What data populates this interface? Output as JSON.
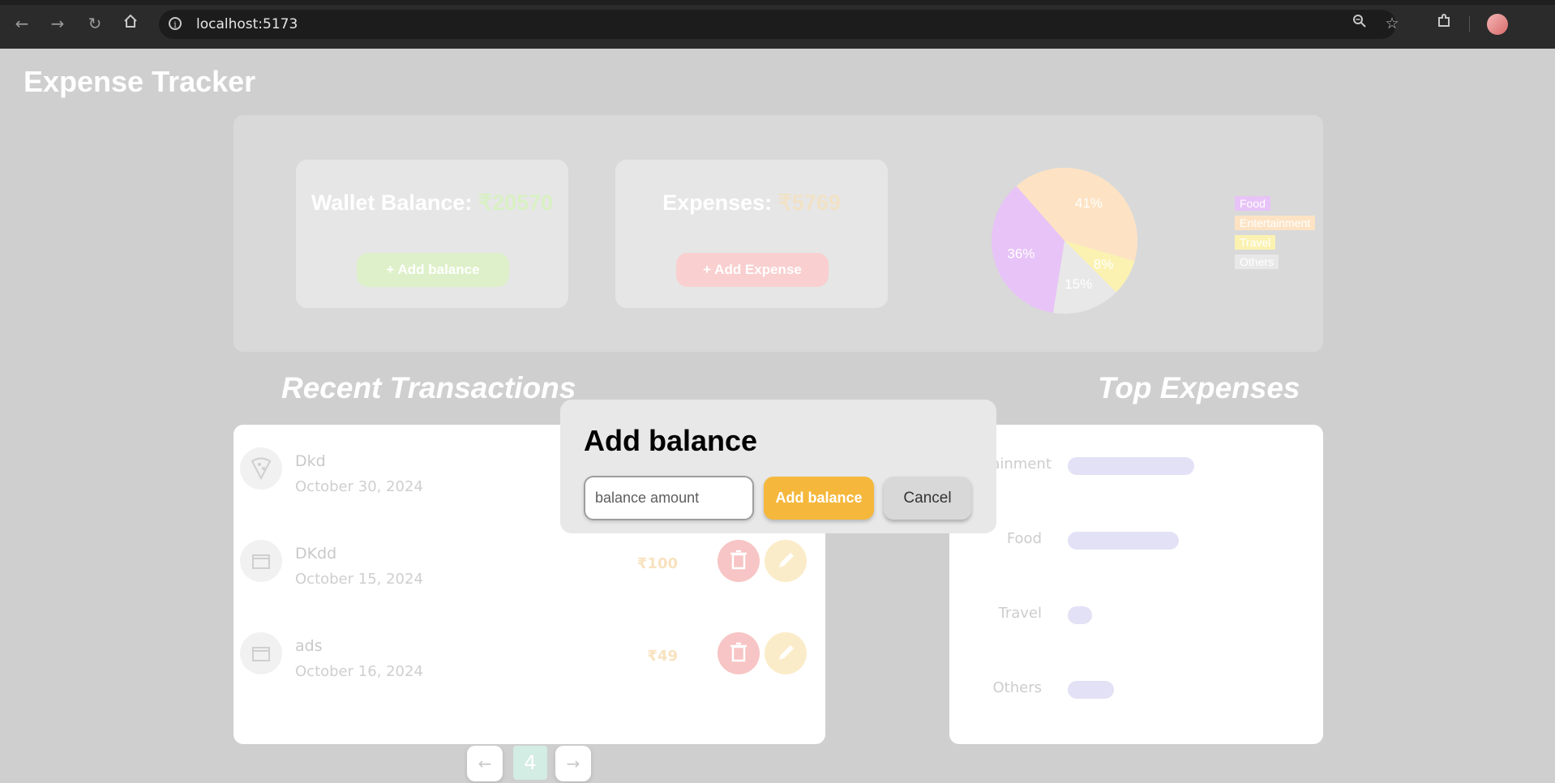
{
  "browser": {
    "url": "localhost:5173",
    "icons": [
      "back-arrow-icon",
      "forward-arrow-icon",
      "reload-icon",
      "home-icon",
      "site-info-icon",
      "zoom-icon",
      "bookmark-star-icon",
      "extensions-icon",
      "profile-avatar"
    ]
  },
  "app": {
    "title": "Expense Tracker"
  },
  "wallet": {
    "label": "Wallet Balance: ",
    "amount": "₹20570",
    "button": "+ Add balance",
    "color": "#d9f0c4"
  },
  "expenses": {
    "label": "Expenses: ",
    "amount": "₹5769",
    "button": "+ Add Expense",
    "color": "#f1e2c7"
  },
  "chart_data": {
    "type": "pie",
    "slices": [
      {
        "name": "Entertainment",
        "value": 41,
        "label": "41%",
        "color": "#fde3c4"
      },
      {
        "name": "Travel",
        "value": 8,
        "label": "8%",
        "color": "#fbf2b2"
      },
      {
        "name": "Others",
        "value": 15,
        "label": "15%",
        "color": "#e8e8e8"
      },
      {
        "name": "Food",
        "value": 36,
        "label": "36%",
        "color": "#e7c3f7"
      }
    ],
    "legend": [
      "Food",
      "Entertainment",
      "Travel",
      "Others"
    ],
    "legend_position": "right"
  },
  "sections": {
    "recent": "Recent Transactions",
    "top": "Top Expenses"
  },
  "transactions": [
    {
      "name": "Dkd",
      "date": "October 30, 2024",
      "amount": "",
      "icon": "pizza-icon"
    },
    {
      "name": "DKdd",
      "date": "October 15, 2024",
      "amount": "₹100",
      "icon": "movie-icon"
    },
    {
      "name": "ads",
      "date": "October 16, 2024",
      "amount": "₹49",
      "icon": "movie-icon"
    }
  ],
  "pagination": {
    "page": "4"
  },
  "top_expenses": [
    {
      "label": "Entertainment",
      "level": 41
    },
    {
      "label": "Food",
      "level": 36
    },
    {
      "label": "Travel",
      "level": 8
    },
    {
      "label": "Others",
      "level": 15
    }
  ],
  "modal": {
    "title": "Add balance",
    "placeholder": "balance amount",
    "add_label": "Add balance",
    "cancel_label": "Cancel"
  }
}
